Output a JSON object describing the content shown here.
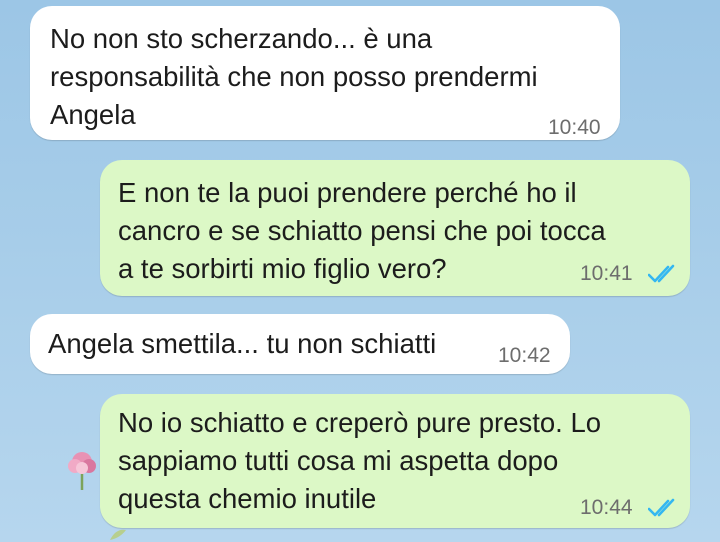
{
  "messages": [
    {
      "direction": "incoming",
      "text": "No non sto scherzando... è una\nresponsabilità che non posso prendermi\nAngela",
      "time": "10:40"
    },
    {
      "direction": "outgoing",
      "text": "E non te la puoi prendere perché ho il\ncancro e se schiatto pensi che poi tocca\na te sorbirti mio figlio vero?",
      "time": "10:41",
      "status": "read"
    },
    {
      "direction": "incoming",
      "text": "Angela smettila... tu non schiatti",
      "time": "10:42"
    },
    {
      "direction": "outgoing",
      "text": "No io schiatto e creperò pure presto. Lo\nsappiamo tutti cosa mi aspetta dopo\nquesta chemio inutile",
      "time": "10:44",
      "status": "read"
    }
  ],
  "icons": {
    "read_receipt": "double-check-icon"
  },
  "colors": {
    "incoming_bubble": "#ffffff",
    "outgoing_bubble": "#dcf8c6",
    "read_receipt": "#34b7f1",
    "timestamp": "#6d6d6d"
  }
}
